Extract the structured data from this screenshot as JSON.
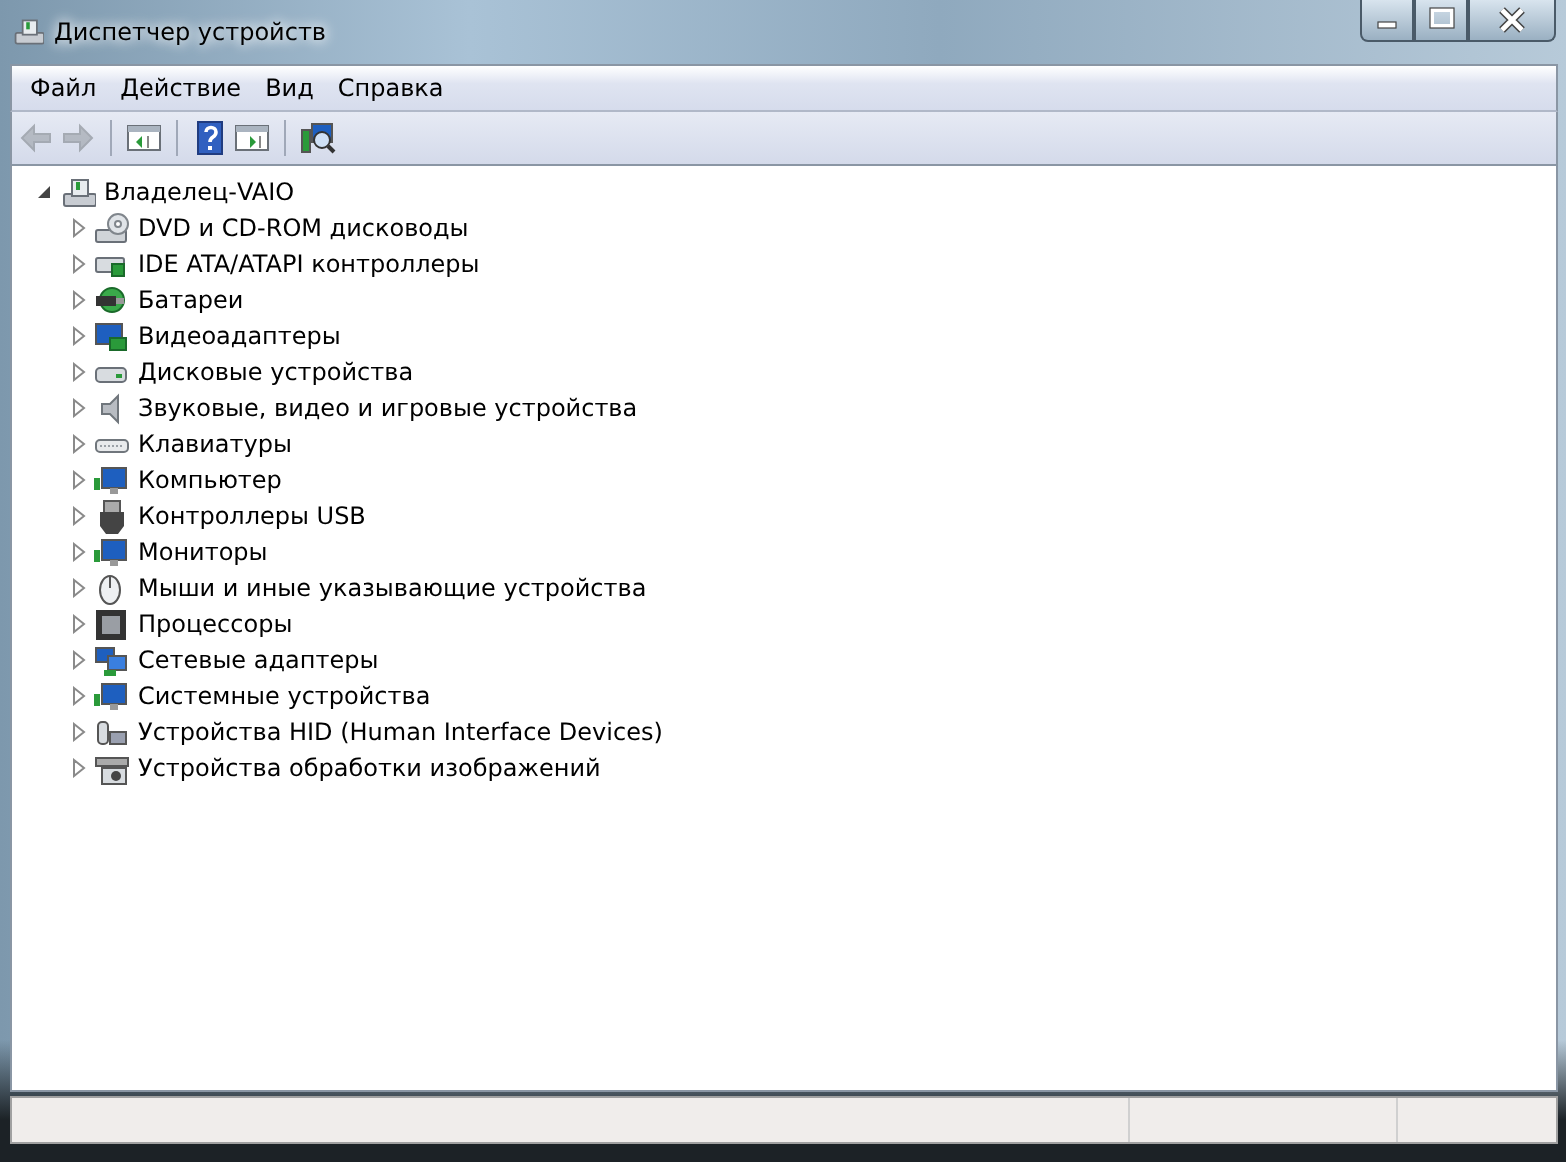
{
  "window": {
    "title": "Диспетчер устройств"
  },
  "menu": [
    "Файл",
    "Действие",
    "Вид",
    "Справка"
  ],
  "toolbar": [
    {
      "kind": "back",
      "disabled": true
    },
    {
      "kind": "forward",
      "disabled": true
    },
    {
      "kind": "separator"
    },
    {
      "kind": "tree-pane",
      "disabled": false
    },
    {
      "kind": "separator"
    },
    {
      "kind": "help",
      "disabled": false
    },
    {
      "kind": "action-pane",
      "disabled": false
    },
    {
      "kind": "separator"
    },
    {
      "kind": "scan",
      "disabled": false
    }
  ],
  "tree": {
    "label": "Владелец-VAIO",
    "kind": "computer",
    "expanded": true,
    "children": [
      {
        "label": "DVD и CD-ROM дисководы",
        "kind": "optical",
        "expanded": false
      },
      {
        "label": "IDE ATA/ATAPI контроллеры",
        "kind": "controller",
        "expanded": false
      },
      {
        "label": "Батареи",
        "kind": "battery",
        "expanded": false
      },
      {
        "label": "Видеоадаптеры",
        "kind": "display",
        "expanded": false
      },
      {
        "label": "Дисковые устройства",
        "kind": "disk",
        "expanded": false
      },
      {
        "label": "Звуковые, видео и игровые устройства",
        "kind": "speaker",
        "expanded": false
      },
      {
        "label": "Клавиатуры",
        "kind": "keyboard",
        "expanded": false
      },
      {
        "label": "Компьютер",
        "kind": "monitor",
        "expanded": false
      },
      {
        "label": "Контроллеры USB",
        "kind": "usb",
        "expanded": false
      },
      {
        "label": "Мониторы",
        "kind": "monitor",
        "expanded": false
      },
      {
        "label": "Мыши и иные указывающие устройства",
        "kind": "mouse",
        "expanded": false
      },
      {
        "label": "Процессоры",
        "kind": "cpu",
        "expanded": false
      },
      {
        "label": "Сетевые адаптеры",
        "kind": "network",
        "expanded": false
      },
      {
        "label": "Системные устройства",
        "kind": "monitor",
        "expanded": false
      },
      {
        "label": "Устройства HID (Human Interface Devices)",
        "kind": "hid",
        "expanded": false
      },
      {
        "label": "Устройства обработки изображений",
        "kind": "camera",
        "expanded": false
      }
    ]
  }
}
